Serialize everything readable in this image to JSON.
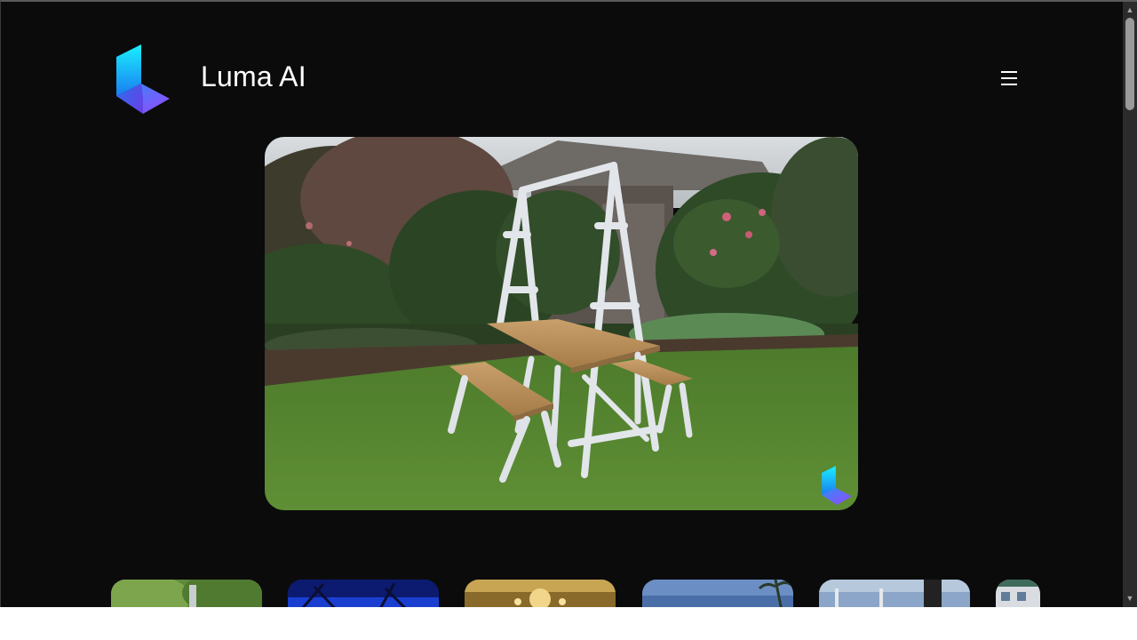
{
  "brand": {
    "name": "Luma AI",
    "accent_cyan": "#19d7f5",
    "accent_violet": "#8a4dff"
  },
  "header": {
    "menu_icon": "hamburger-menu-icon"
  },
  "hero": {
    "subject": "picnic-table-3d-capture",
    "badge_icon": "luma-logo-badge-icon"
  },
  "thumbnails": [
    {
      "name": "capture-trees"
    },
    {
      "name": "capture-night-sky"
    },
    {
      "name": "capture-chandelier-hall"
    },
    {
      "name": "capture-palm-street"
    },
    {
      "name": "capture-balcony"
    },
    {
      "name": "capture-building"
    }
  ]
}
